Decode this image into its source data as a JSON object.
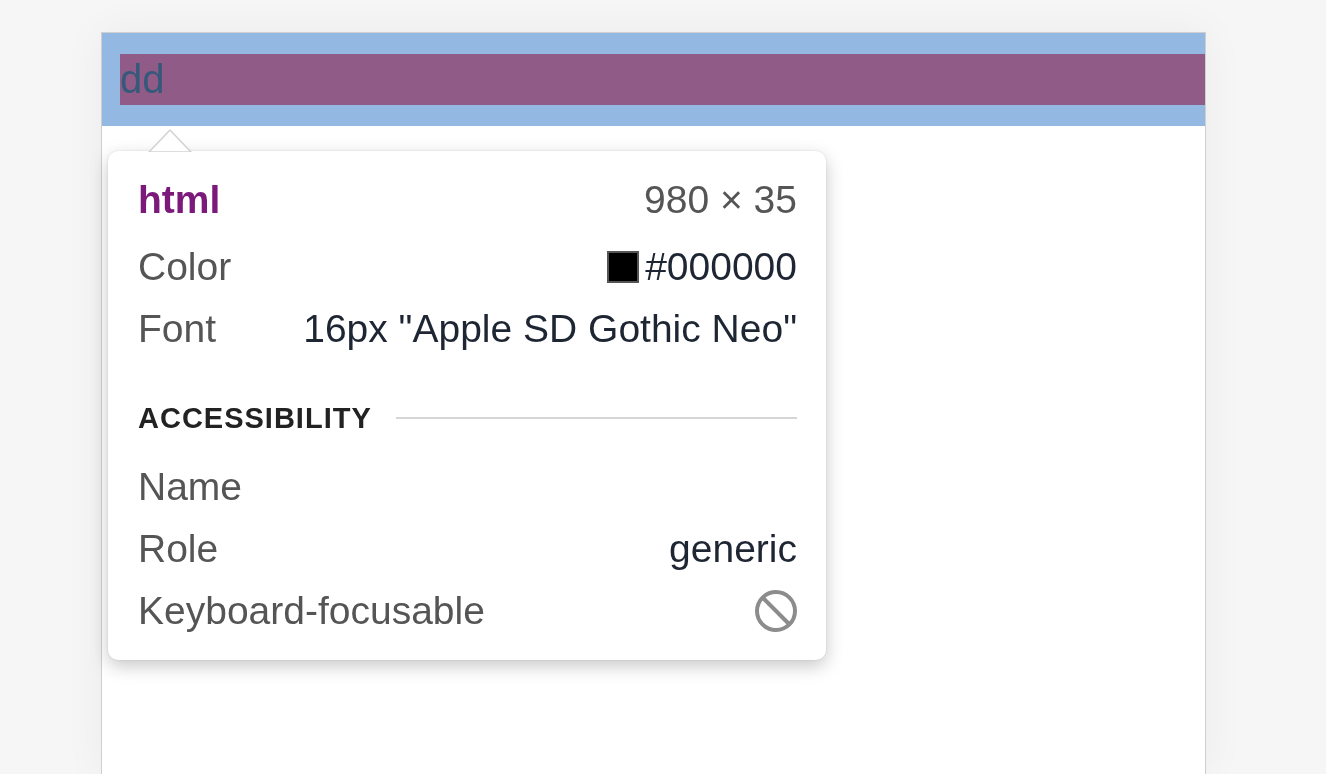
{
  "page": {
    "text": "dd"
  },
  "inspector_tooltip": {
    "element": {
      "tag": "html",
      "size": "980 × 35"
    },
    "properties": [
      {
        "label": "Color",
        "kind": "color",
        "value": "#000000",
        "color": "#000000"
      },
      {
        "label": "Font",
        "kind": "text",
        "value": "16px \"Apple SD Gothic Neo\""
      }
    ],
    "accessibility": {
      "title": "ACCESSIBILITY",
      "rows": [
        {
          "label": "Name",
          "kind": "text"
        },
        {
          "label": "Role",
          "kind": "text",
          "value": "generic"
        },
        {
          "label": "Keyboard-focusable",
          "kind": "flag",
          "on": false
        }
      ]
    }
  }
}
